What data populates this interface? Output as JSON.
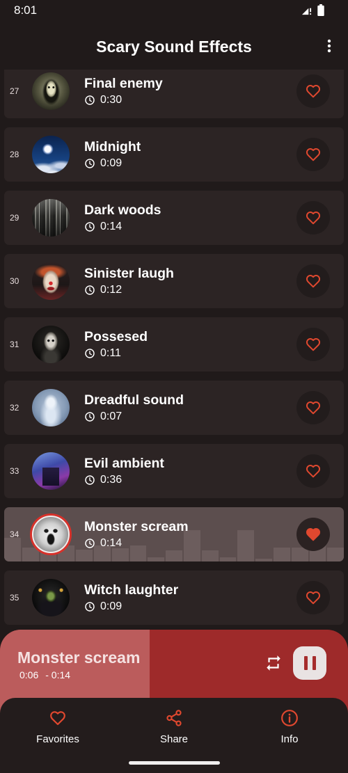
{
  "status_bar": {
    "time": "8:01"
  },
  "header": {
    "title": "Scary Sound Effects"
  },
  "sounds": [
    {
      "number": "27",
      "title": "Final enemy",
      "duration": "0:30",
      "favorite": false,
      "playing": false
    },
    {
      "number": "28",
      "title": "Midnight",
      "duration": "0:09",
      "favorite": false,
      "playing": false
    },
    {
      "number": "29",
      "title": "Dark woods",
      "duration": "0:14",
      "favorite": false,
      "playing": false
    },
    {
      "number": "30",
      "title": "Sinister laugh",
      "duration": "0:12",
      "favorite": false,
      "playing": false
    },
    {
      "number": "31",
      "title": "Possesed",
      "duration": "0:11",
      "favorite": false,
      "playing": false
    },
    {
      "number": "32",
      "title": "Dreadful sound",
      "duration": "0:07",
      "favorite": false,
      "playing": false
    },
    {
      "number": "33",
      "title": "Evil ambient",
      "duration": "0:36",
      "favorite": false,
      "playing": false
    },
    {
      "number": "34",
      "title": "Monster scream",
      "duration": "0:14",
      "favorite": true,
      "playing": true
    },
    {
      "number": "35",
      "title": "Witch laughter",
      "duration": "0:09",
      "favorite": false,
      "playing": false
    }
  ],
  "waveform_levels": [
    0.44,
    0.26,
    0.35,
    0.3,
    0.22,
    0.3,
    0.25,
    0.3,
    0.08,
    0.2,
    0.58,
    0.2,
    0.08,
    0.58,
    0.05,
    0.26,
    0.26,
    0.45,
    0.26
  ],
  "now_playing": {
    "title": "Monster scream",
    "elapsed": "0:06",
    "remaining": "- 0:14",
    "progress": 0.43,
    "is_playing": true
  },
  "bottom_nav": [
    {
      "label": "Favorites",
      "icon": "heart-outline-icon"
    },
    {
      "label": "Share",
      "icon": "share-icon"
    },
    {
      "label": "Info",
      "icon": "info-icon"
    }
  ],
  "colors": {
    "background": "#201a1a",
    "card": "#2c2424",
    "card_active": "#5c4e4e",
    "accent": "#e0482f",
    "player_progress": "#bb5c5c",
    "player_track": "#9e2a2a"
  },
  "icons": {
    "menu": "more-vert-icon",
    "duration": "clock-icon",
    "favorite": "heart-icon",
    "repeat": "repeat-icon",
    "pause": "pause-icon"
  }
}
